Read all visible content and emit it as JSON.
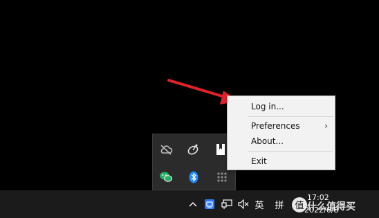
{
  "context_menu": {
    "items": [
      {
        "label": "Log in...",
        "has_submenu": false
      },
      {
        "label": "Preferences",
        "has_submenu": true
      },
      {
        "label": "About...",
        "has_submenu": false
      },
      {
        "label": "Exit",
        "has_submenu": false
      }
    ],
    "submenu_chevron": "›"
  },
  "tray_overflow": {
    "icons": [
      "cloud-offline-icon",
      "satellite-dish-icon",
      "bookmark-app-icon",
      "wechat-icon",
      "bluetooth-icon",
      "grid-app-icon"
    ]
  },
  "taskbar": {
    "show_hidden_icons_glyph": "^",
    "ime_label": "英",
    "pinyin_label": "拼",
    "clock_time": "17:02",
    "clock_date": "2022/6/8",
    "icons": [
      "chevron-up-icon",
      "input-method-icon",
      "network-icon",
      "volume-muted-icon",
      "ime-mode-icon",
      "pinyin-icon"
    ]
  },
  "watermark": {
    "text": "什么值得买"
  },
  "colors": {
    "desktop": "#000000",
    "menu_bg": "#f2f2f2",
    "taskbar_bg": "#1b1b1b",
    "flyout_bg": "#2b2b2b",
    "arrow": "#e0202a",
    "bluetooth": "#1e88ff",
    "wechat": "#2aae67",
    "ime_blue": "#2e7cf6"
  }
}
